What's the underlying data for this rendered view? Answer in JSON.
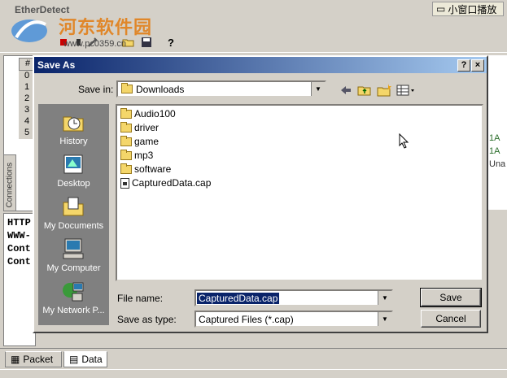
{
  "app": {
    "title": "EtherDetect",
    "watermark_title": "河东软件园",
    "watermark_url": "www.pc0359.cn",
    "small_window_label": "小窗口播放",
    "toolbar_icons": [
      "record-icon",
      "stop-icon",
      "tools-icon",
      "open-folder-icon",
      "save-icon",
      "help-icon"
    ]
  },
  "grid": {
    "header": "#",
    "rows": [
      "0",
      "1",
      "2",
      "3",
      "4",
      "5"
    ],
    "side_tab": "Connections"
  },
  "right_strip": {
    "lines": [
      "1A",
      "1A",
      "Una"
    ]
  },
  "text_area": {
    "lines": [
      "HTTP",
      "WWW-",
      "Cont",
      "Cont"
    ]
  },
  "bottom_tabs": [
    {
      "label": "Packet",
      "icon": "packet-icon"
    },
    {
      "label": "Data",
      "icon": "data-icon"
    }
  ],
  "dialog": {
    "title": "Save As",
    "help_btn": "?",
    "close_btn": "×",
    "save_in_label": "Save in:",
    "save_in_value": "Downloads",
    "places": [
      {
        "label": "History",
        "icon": "history-icon"
      },
      {
        "label": "Desktop",
        "icon": "desktop-icon"
      },
      {
        "label": "My Documents",
        "icon": "my-documents-icon"
      },
      {
        "label": "My Computer",
        "icon": "my-computer-icon"
      },
      {
        "label": "My Network P...",
        "icon": "my-network-icon"
      }
    ],
    "files": [
      {
        "name": "Audio100",
        "type": "folder"
      },
      {
        "name": "driver",
        "type": "folder"
      },
      {
        "name": "game",
        "type": "folder"
      },
      {
        "name": "mp3",
        "type": "folder"
      },
      {
        "name": "software",
        "type": "folder"
      },
      {
        "name": "CapturedData.cap",
        "type": "file"
      }
    ],
    "file_name_label": "File name:",
    "file_name_value": "CapturedData.cap",
    "save_type_label": "Save as type:",
    "save_type_value": "Captured Files (*.cap)",
    "save_button": "Save",
    "cancel_button": "Cancel"
  }
}
